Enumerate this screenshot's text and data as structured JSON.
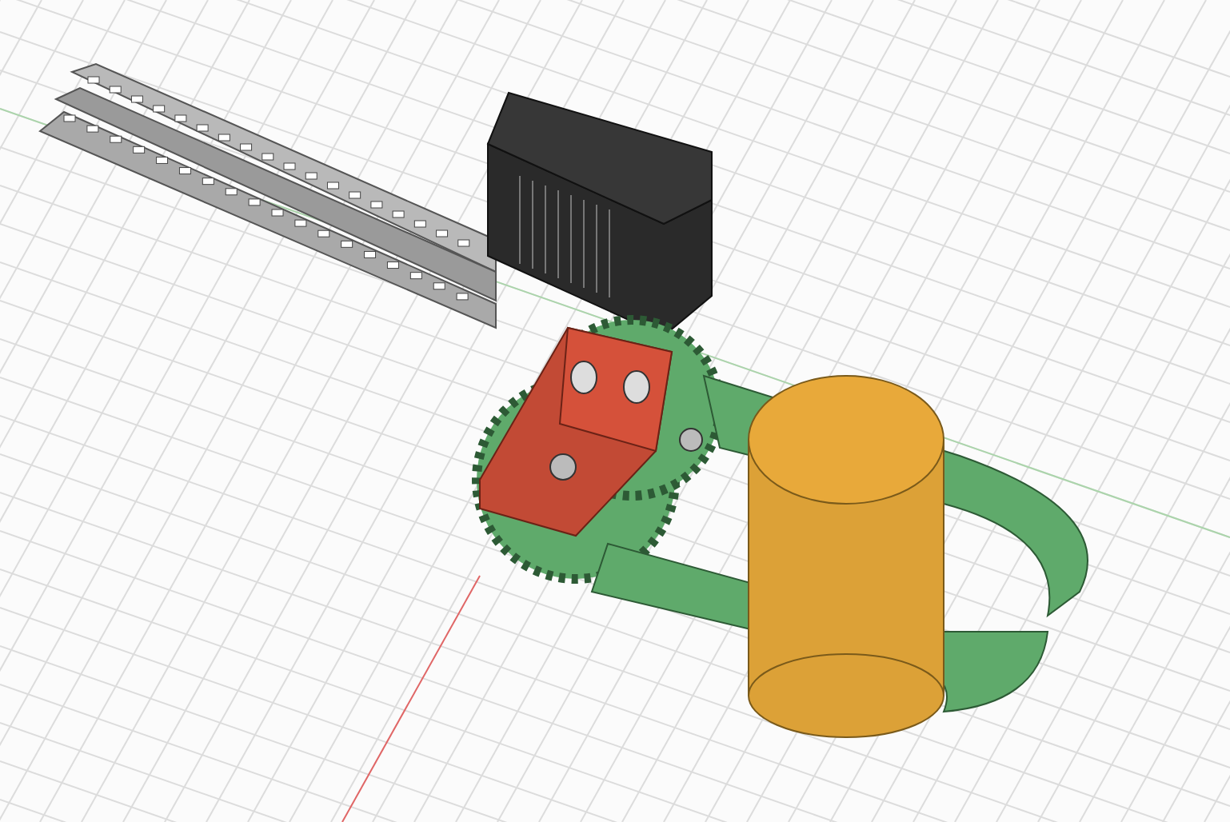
{
  "viewport": {
    "grid": true
  },
  "parts": [
    {
      "kind": "rail",
      "color": "#9a9a9a"
    },
    {
      "kind": "motor",
      "color": "#2a2a2a"
    },
    {
      "kind": "gripper",
      "color": "#5faa6b"
    },
    {
      "kind": "bracket",
      "color": "#c24a35"
    },
    {
      "kind": "cylinder",
      "color": "#e8a93a"
    }
  ]
}
